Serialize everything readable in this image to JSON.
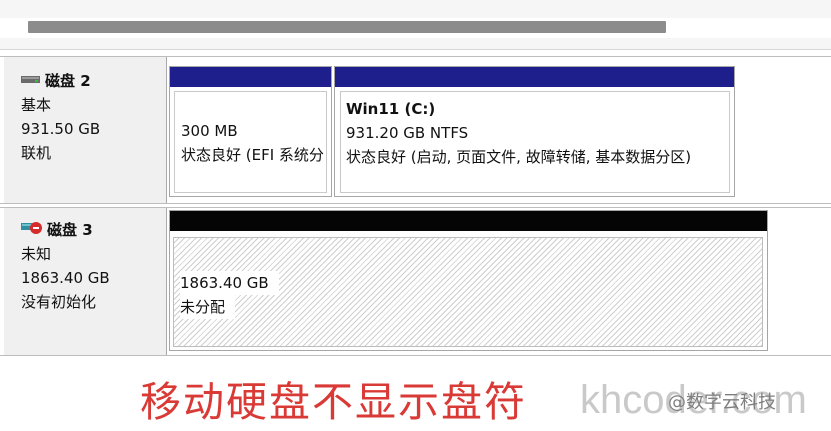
{
  "disks": [
    {
      "name": "磁盘 2",
      "type": "基本",
      "size": "931.50 GB",
      "status": "联机",
      "icon": "disk-icon",
      "partitions": [
        {
          "title": "",
          "size": "300 MB",
          "status": "状态良好 (EFI 系统分区)"
        },
        {
          "title": "Win11  (C:)",
          "size": "931.20 GB NTFS",
          "status": "状态良好 (启动, 页面文件, 故障转储, 基本数据分区)"
        }
      ]
    },
    {
      "name": "磁盘 3",
      "type": "未知",
      "size": "1863.40 GB",
      "status": "没有初始化",
      "icon": "disk-not-initialized-icon",
      "partitions": [
        {
          "size": "1863.40 GB",
          "status": "未分配"
        }
      ]
    }
  ],
  "caption": "移动硬盘不显示盘符",
  "watermark": {
    "site": "khcoder.com",
    "account": "@数字云科技"
  },
  "colors": {
    "primary_bar": "#1e1e8c",
    "unallocated_bar": "#050505",
    "caption": "#d93a36"
  }
}
